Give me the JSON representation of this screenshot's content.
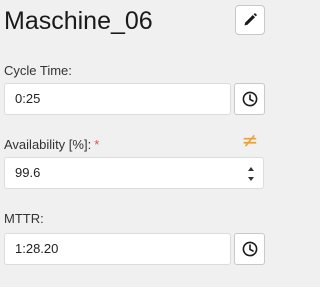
{
  "header": {
    "title": "Maschine_06",
    "edit_icon": "pencil-icon"
  },
  "fields": {
    "cycle_time": {
      "label": "Cycle Time:",
      "value": "0:25",
      "button_icon": "clock-icon"
    },
    "availability": {
      "label": "Availability [%]:",
      "required_marker": "*",
      "value": "99.6",
      "status_icon": "not-equal-icon",
      "status_color": "#f0a030"
    },
    "mttr": {
      "label": "MTTR:",
      "value": "1:28.20",
      "button_icon": "clock-icon"
    }
  }
}
